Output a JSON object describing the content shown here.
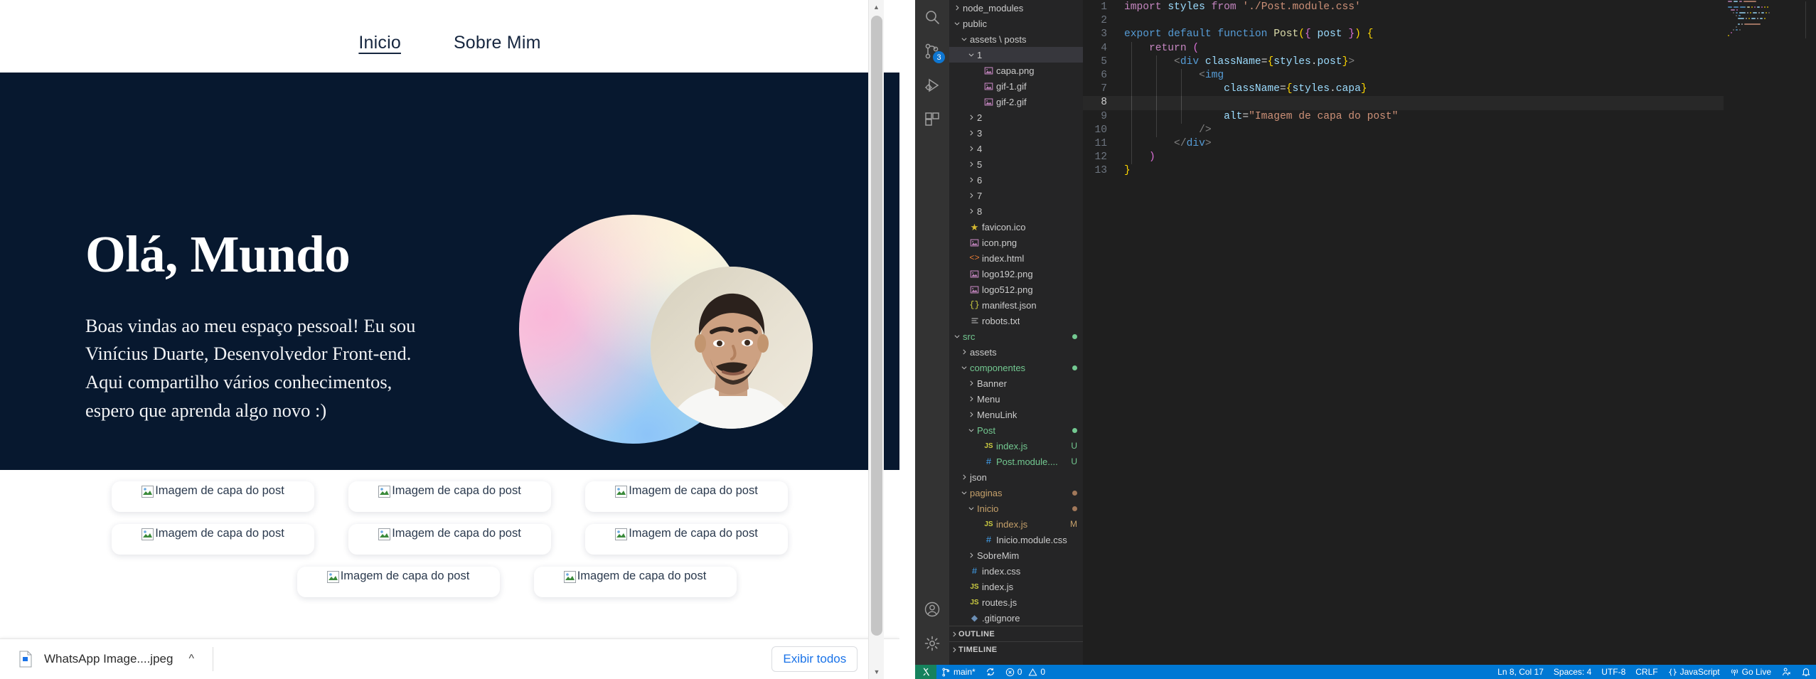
{
  "browser": {
    "nav": {
      "links": [
        {
          "label": "Inicio",
          "active": true
        },
        {
          "label": "Sobre Mim",
          "active": false
        }
      ]
    },
    "banner": {
      "title": "Olá, Mundo",
      "text": "Boas vindas ao meu espaço pessoal! Eu sou Vinícius Duarte, Desenvolvedor Front-end. Aqui compartilho vários conhecimentos, espero que aprenda algo novo :)",
      "background_color": "#07182f",
      "avatar_alt": "Foto de perfil"
    },
    "posts": {
      "alt_text": "Imagem de capa do post",
      "rows": [
        {
          "cards": 3
        },
        {
          "cards": 3
        },
        {
          "cards": 2
        }
      ]
    },
    "downloads": {
      "file_name": "WhatsApp Image....jpeg",
      "caret_icon": "chevron-up-icon",
      "show_all_label": "Exibir todos",
      "close_icon": "close-icon",
      "link_color": "#1a73e8"
    }
  },
  "vscode": {
    "activity_bar": [
      {
        "icon": "search-icon",
        "badge": null
      },
      {
        "icon": "source-control-icon",
        "badge": "3"
      },
      {
        "icon": "run-and-debug-icon",
        "badge": null
      },
      {
        "icon": "extensions-icon",
        "badge": null
      }
    ],
    "activity_bar_bottom": [
      {
        "icon": "account-icon"
      },
      {
        "icon": "gear-icon"
      }
    ],
    "explorer": {
      "tree": [
        {
          "label": "node_modules",
          "indent": 0,
          "type": "folder",
          "state": "collapsed",
          "color": "default"
        },
        {
          "label": "public",
          "indent": 0,
          "type": "folder",
          "state": "expanded",
          "color": "default"
        },
        {
          "label": "assets \\ posts",
          "indent": 1,
          "type": "folder",
          "state": "expanded",
          "color": "default"
        },
        {
          "label": "1",
          "indent": 2,
          "type": "folder",
          "state": "expanded",
          "color": "default",
          "selected": true
        },
        {
          "label": "capa.png",
          "indent": 3,
          "type": "image",
          "color": "default"
        },
        {
          "label": "gif-1.gif",
          "indent": 3,
          "type": "image",
          "color": "default"
        },
        {
          "label": "gif-2.gif",
          "indent": 3,
          "type": "image",
          "color": "default"
        },
        {
          "label": "2",
          "indent": 2,
          "type": "folder",
          "state": "collapsed",
          "color": "default"
        },
        {
          "label": "3",
          "indent": 2,
          "type": "folder",
          "state": "collapsed",
          "color": "default"
        },
        {
          "label": "4",
          "indent": 2,
          "type": "folder",
          "state": "collapsed",
          "color": "default"
        },
        {
          "label": "5",
          "indent": 2,
          "type": "folder",
          "state": "collapsed",
          "color": "default"
        },
        {
          "label": "6",
          "indent": 2,
          "type": "folder",
          "state": "collapsed",
          "color": "default"
        },
        {
          "label": "7",
          "indent": 2,
          "type": "folder",
          "state": "collapsed",
          "color": "default"
        },
        {
          "label": "8",
          "indent": 2,
          "type": "folder",
          "state": "collapsed",
          "color": "default"
        },
        {
          "label": "favicon.ico",
          "indent": 1,
          "type": "star",
          "color": "default"
        },
        {
          "label": "icon.png",
          "indent": 1,
          "type": "image",
          "color": "default"
        },
        {
          "label": "index.html",
          "indent": 1,
          "type": "html",
          "color": "default"
        },
        {
          "label": "logo192.png",
          "indent": 1,
          "type": "image",
          "color": "default"
        },
        {
          "label": "logo512.png",
          "indent": 1,
          "type": "image",
          "color": "default"
        },
        {
          "label": "manifest.json",
          "indent": 1,
          "type": "json",
          "color": "default"
        },
        {
          "label": "robots.txt",
          "indent": 1,
          "type": "text",
          "color": "default"
        },
        {
          "label": "src",
          "indent": 0,
          "type": "folder",
          "state": "expanded",
          "color": "green",
          "dot": "#73c991"
        },
        {
          "label": "assets",
          "indent": 1,
          "type": "folder",
          "state": "collapsed",
          "color": "default"
        },
        {
          "label": "componentes",
          "indent": 1,
          "type": "folder",
          "state": "expanded",
          "color": "green",
          "dot": "#73c991"
        },
        {
          "label": "Banner",
          "indent": 2,
          "type": "folder",
          "state": "collapsed",
          "color": "default"
        },
        {
          "label": "Menu",
          "indent": 2,
          "type": "folder",
          "state": "collapsed",
          "color": "default"
        },
        {
          "label": "MenuLink",
          "indent": 2,
          "type": "folder",
          "state": "collapsed",
          "color": "default"
        },
        {
          "label": "Post",
          "indent": 2,
          "type": "folder",
          "state": "expanded",
          "color": "green",
          "dot": "#73c991"
        },
        {
          "label": "index.js",
          "indent": 3,
          "type": "js",
          "color": "green",
          "badge": "U"
        },
        {
          "label": "Post.module....",
          "indent": 3,
          "type": "css",
          "color": "green",
          "badge": "U"
        },
        {
          "label": "json",
          "indent": 1,
          "type": "folder",
          "state": "collapsed",
          "color": "default"
        },
        {
          "label": "paginas",
          "indent": 1,
          "type": "folder",
          "state": "expanded",
          "color": "tan",
          "dot": "#a1785a"
        },
        {
          "label": "Inicio",
          "indent": 2,
          "type": "folder",
          "state": "expanded",
          "color": "tan",
          "dot": "#a1785a"
        },
        {
          "label": "index.js",
          "indent": 3,
          "type": "js",
          "color": "tan",
          "badge": "M"
        },
        {
          "label": "Inicio.module.css",
          "indent": 3,
          "type": "css",
          "color": "default"
        },
        {
          "label": "SobreMim",
          "indent": 2,
          "type": "folder",
          "state": "collapsed",
          "color": "default"
        },
        {
          "label": "index.css",
          "indent": 1,
          "type": "css",
          "color": "default"
        },
        {
          "label": "index.js",
          "indent": 1,
          "type": "js",
          "color": "default"
        },
        {
          "label": "routes.js",
          "indent": 1,
          "type": "js",
          "color": "default"
        },
        {
          "label": ".gitignore",
          "indent": 1,
          "type": "git",
          "color": "default"
        }
      ],
      "panels": [
        {
          "label": "OUTLINE"
        },
        {
          "label": "TIMELINE"
        }
      ]
    },
    "editor": {
      "lines": [
        {
          "n": 1,
          "current": false,
          "guides": 0,
          "tokens": [
            {
              "t": "import ",
              "c": "k-import"
            },
            {
              "t": "styles ",
              "c": "k-var"
            },
            {
              "t": "from ",
              "c": "k-import"
            },
            {
              "t": "'./Post.module.css'",
              "c": "k-str"
            }
          ]
        },
        {
          "n": 2,
          "current": false,
          "guides": 0,
          "tokens": []
        },
        {
          "n": 3,
          "current": false,
          "guides": 0,
          "tokens": [
            {
              "t": "export ",
              "c": "k-kw"
            },
            {
              "t": "default ",
              "c": "k-kw"
            },
            {
              "t": "function ",
              "c": "k-kw"
            },
            {
              "t": "Post",
              "c": "k-fn"
            },
            {
              "t": "(",
              "c": "k-brace-y"
            },
            {
              "t": "{ ",
              "c": "k-brace-p"
            },
            {
              "t": "post ",
              "c": "k-var"
            },
            {
              "t": "}",
              "c": "k-brace-p"
            },
            {
              "t": ")",
              "c": "k-brace-y"
            },
            {
              "t": " {",
              "c": "k-brace-y"
            }
          ]
        },
        {
          "n": 4,
          "current": false,
          "guides": 1,
          "tokens": [
            {
              "t": "    return ",
              "c": "k-import"
            },
            {
              "t": "(",
              "c": "k-brace-p"
            }
          ]
        },
        {
          "n": 5,
          "current": false,
          "guides": 2,
          "tokens": [
            {
              "t": "        <",
              "c": "k-punct"
            },
            {
              "t": "div",
              "c": "k-tag"
            },
            {
              "t": " className",
              "c": "k-attr"
            },
            {
              "t": "=",
              "c": "k-plain"
            },
            {
              "t": "{",
              "c": "k-brace-y"
            },
            {
              "t": "styles",
              "c": "k-var"
            },
            {
              "t": ".",
              "c": "k-plain"
            },
            {
              "t": "post",
              "c": "k-var"
            },
            {
              "t": "}",
              "c": "k-brace-y"
            },
            {
              "t": ">",
              "c": "k-punct"
            }
          ]
        },
        {
          "n": 6,
          "current": false,
          "guides": 3,
          "tokens": [
            {
              "t": "            <",
              "c": "k-punct"
            },
            {
              "t": "img",
              "c": "k-tag"
            }
          ]
        },
        {
          "n": 7,
          "current": false,
          "guides": 3,
          "tokens": [
            {
              "t": "                className",
              "c": "k-attr"
            },
            {
              "t": "=",
              "c": "k-plain"
            },
            {
              "t": "{",
              "c": "k-brace-y"
            },
            {
              "t": "styles",
              "c": "k-var"
            },
            {
              "t": ".",
              "c": "k-plain"
            },
            {
              "t": "capa",
              "c": "k-var"
            },
            {
              "t": "}",
              "c": "k-brace-y"
            }
          ]
        },
        {
          "n": 8,
          "current": true,
          "guides": 3,
          "tokens": []
        },
        {
          "n": 9,
          "current": false,
          "guides": 3,
          "tokens": [
            {
              "t": "                alt",
              "c": "k-attr"
            },
            {
              "t": "=",
              "c": "k-plain"
            },
            {
              "t": "\"Imagem de capa do post\"",
              "c": "k-str"
            }
          ]
        },
        {
          "n": 10,
          "current": false,
          "guides": 2,
          "tokens": [
            {
              "t": "            />",
              "c": "k-punct"
            }
          ]
        },
        {
          "n": 11,
          "current": false,
          "guides": 1,
          "tokens": [
            {
              "t": "        </",
              "c": "k-punct"
            },
            {
              "t": "div",
              "c": "k-tag"
            },
            {
              "t": ">",
              "c": "k-punct"
            }
          ]
        },
        {
          "n": 12,
          "current": false,
          "guides": 1,
          "tokens": [
            {
              "t": "    )",
              "c": "k-brace-p"
            }
          ]
        },
        {
          "n": 13,
          "current": false,
          "guides": 0,
          "tokens": [
            {
              "t": "}",
              "c": "k-brace-y"
            }
          ]
        }
      ]
    },
    "status_bar": {
      "remote_icon": "remote-window-icon",
      "branch": "main*",
      "sync_icon": "sync-icon",
      "errors": "0",
      "warnings": "0",
      "cursor": "Ln 8, Col 17",
      "spaces": "Spaces: 4",
      "encoding": "UTF-8",
      "eol": "CRLF",
      "language": "JavaScript",
      "go_live": "Go Live",
      "feedback_icon": "feedback-icon",
      "bell_icon": "bell-icon",
      "background_color": "#0078d4"
    }
  }
}
